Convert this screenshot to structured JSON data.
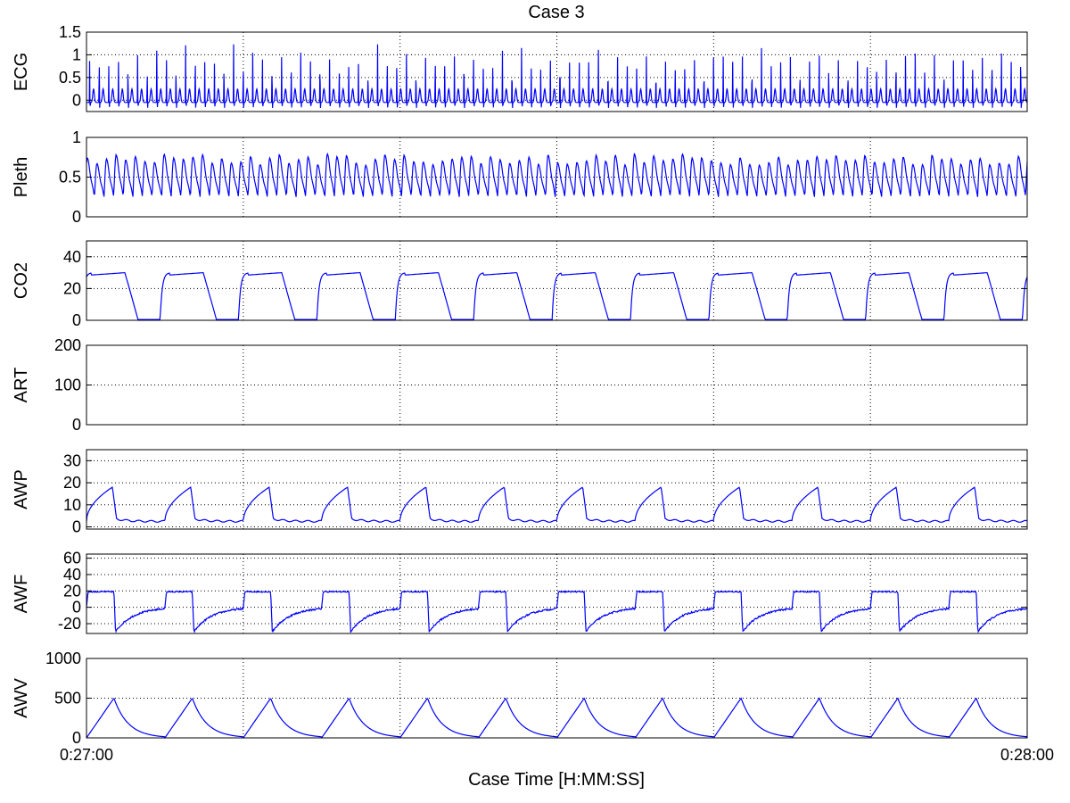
{
  "chart_data": {
    "type": "line",
    "title": "Case 3",
    "xlabel": "Case Time [H:MM:SS]",
    "x_tick_labels": [
      "0:27:00",
      "0:28:00"
    ],
    "x_range_seconds": [
      0,
      60
    ],
    "grid": true,
    "line_color": "#0000ff",
    "panels": [
      {
        "ylabel": "ECG",
        "ylim": [
          -0.25,
          1.5
        ],
        "yticks": [
          0,
          0.5,
          1,
          1.5
        ],
        "ytick_labels": [
          "0",
          "0.5",
          "1",
          "1.5"
        ],
        "waveform": "ecg",
        "beats_per_minute": 98,
        "baseline": -0.05,
        "t_wave_peak": 0.28,
        "r_peak_range": [
          0.9,
          1.32
        ]
      },
      {
        "ylabel": "Pleth",
        "ylim": [
          0,
          1
        ],
        "yticks": [
          0,
          0.5,
          1
        ],
        "ytick_labels": [
          "0",
          "0.5",
          "1"
        ],
        "waveform": "pleth",
        "beats_per_minute": 98,
        "min": 0.25,
        "max_range": [
          0.65,
          0.8
        ]
      },
      {
        "ylabel": "CO2",
        "ylim": [
          0,
          50
        ],
        "yticks": [
          0,
          20,
          40
        ],
        "ytick_labels": [
          "0",
          "20",
          "40"
        ],
        "waveform": "co2",
        "breaths_per_minute": 12,
        "plateau": 30,
        "baseline": 0.5
      },
      {
        "ylabel": "ART",
        "ylim": [
          0,
          200
        ],
        "yticks": [
          0,
          100,
          200
        ],
        "ytick_labels": [
          "0",
          "100",
          "200"
        ],
        "waveform": "none"
      },
      {
        "ylabel": "AWP",
        "ylim": [
          -1,
          35
        ],
        "yticks": [
          0,
          10,
          20,
          30
        ],
        "ytick_labels": [
          "0",
          "10",
          "20",
          "30"
        ],
        "waveform": "awp",
        "breaths_per_minute": 12,
        "peak": 18,
        "baseline": 2.5
      },
      {
        "ylabel": "AWF",
        "ylim": [
          -32,
          65
        ],
        "yticks": [
          -20,
          0,
          20,
          40,
          60
        ],
        "ytick_labels": [
          "-20",
          "0",
          "20",
          "40",
          "60"
        ],
        "waveform": "awf",
        "breaths_per_minute": 12,
        "insp_flow": 19,
        "exp_min": -30
      },
      {
        "ylabel": "AWV",
        "ylim": [
          0,
          1000
        ],
        "yticks": [
          0,
          500,
          1000
        ],
        "ytick_labels": [
          "0",
          "500",
          "1000"
        ],
        "waveform": "awv",
        "breaths_per_minute": 12,
        "peak": 500
      }
    ]
  }
}
